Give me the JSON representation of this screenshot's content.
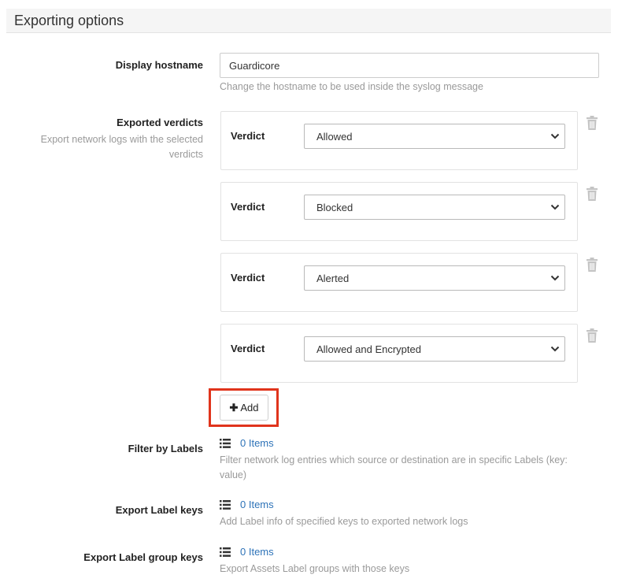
{
  "section": {
    "title": "Exporting options"
  },
  "display_hostname": {
    "label": "Display hostname",
    "value": "Guardicore",
    "help": "Change the hostname to be used inside the syslog message"
  },
  "exported_verdicts": {
    "label": "Exported verdicts",
    "description": "Export network logs with the selected verdicts",
    "items": [
      {
        "label": "Verdict",
        "value": "Allowed"
      },
      {
        "label": "Verdict",
        "value": "Blocked"
      },
      {
        "label": "Verdict",
        "value": "Alerted"
      },
      {
        "label": "Verdict",
        "value": "Allowed and Encrypted"
      }
    ],
    "add_label": "Add",
    "add_highlight_color": "#e0341c"
  },
  "filter_by_labels": {
    "label": "Filter by Labels",
    "items_text": "0 Items",
    "help": "Filter network log entries which source or destination are in specific Labels (key: value)"
  },
  "export_label_keys": {
    "label": "Export Label keys",
    "items_text": "0 Items",
    "help": "Add Label info of specified keys to exported network logs"
  },
  "export_label_group_keys": {
    "label": "Export Label group keys",
    "items_text": "0 Items",
    "help": "Export Assets Label groups with those keys"
  },
  "colors": {
    "link": "#2e73b8",
    "muted": "#9a9a9a",
    "icon": "#c4c4c4"
  },
  "icons": {
    "delete": "trash-icon",
    "list": "list-icon",
    "add": "plus-icon",
    "select": "chevron-down-icon"
  }
}
